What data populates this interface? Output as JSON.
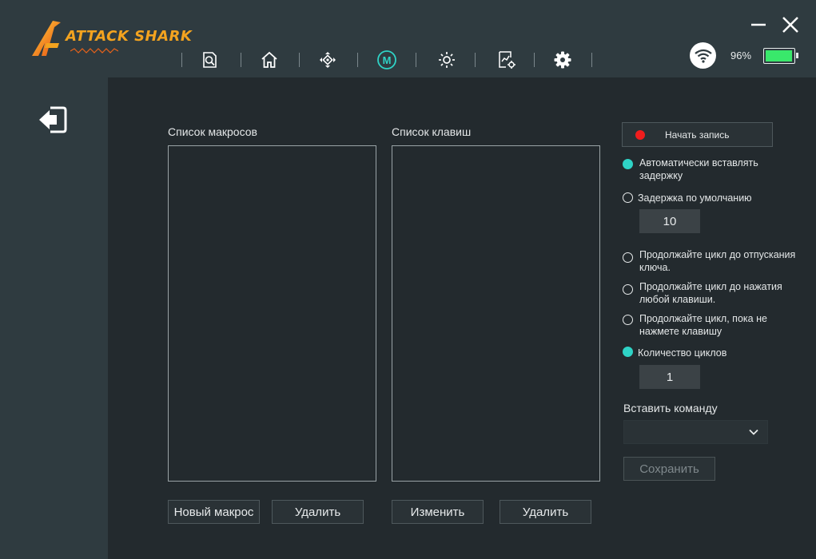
{
  "app": {
    "logo_text": "ATTACK SHARK",
    "nav": [
      {
        "name": "nav-performance",
        "icon": "magnifier-document-icon",
        "active": false
      },
      {
        "name": "nav-home",
        "icon": "home-icon",
        "active": false
      },
      {
        "name": "nav-key-assign",
        "icon": "dpad-icon",
        "active": false
      },
      {
        "name": "nav-macro",
        "icon": "macro-m-icon",
        "active": true
      },
      {
        "name": "nav-lighting",
        "icon": "brightness-icon",
        "active": false
      },
      {
        "name": "nav-advanced",
        "icon": "chart-gear-icon",
        "active": false
      },
      {
        "name": "nav-settings",
        "icon": "gear-icon",
        "active": false
      }
    ],
    "accent_color": "#2fd3c6",
    "battery_percent_label": "96%",
    "battery_level": 0.96
  },
  "macro": {
    "macro_list_label": "Список макросов",
    "key_list_label": "Список клавиш",
    "buttons": {
      "new_macro": "Новый макрос",
      "delete_macro": "Удалить",
      "edit_key": "Изменить",
      "delete_key": "Удалить",
      "save": "Сохранить"
    },
    "record": {
      "label": "Начать запись",
      "dot_color": "#f01d1d"
    },
    "delay_options": {
      "auto": "Автоматически вставлять задержку",
      "default": "Задержка по умолчанию",
      "default_value": "10"
    },
    "loop_options": {
      "until_release": "Продолжайте цикл до отпускания ключа.",
      "until_any_key": "Продолжайте цикл до нажатия любой клавиши.",
      "until_key_pressed": "Продолжайте цикл, пока не нажмете клавишу",
      "loop_count": "Количество циклов",
      "loop_count_value": "1"
    },
    "insert_command_label": "Вставить команду",
    "insert_command_value": ""
  }
}
